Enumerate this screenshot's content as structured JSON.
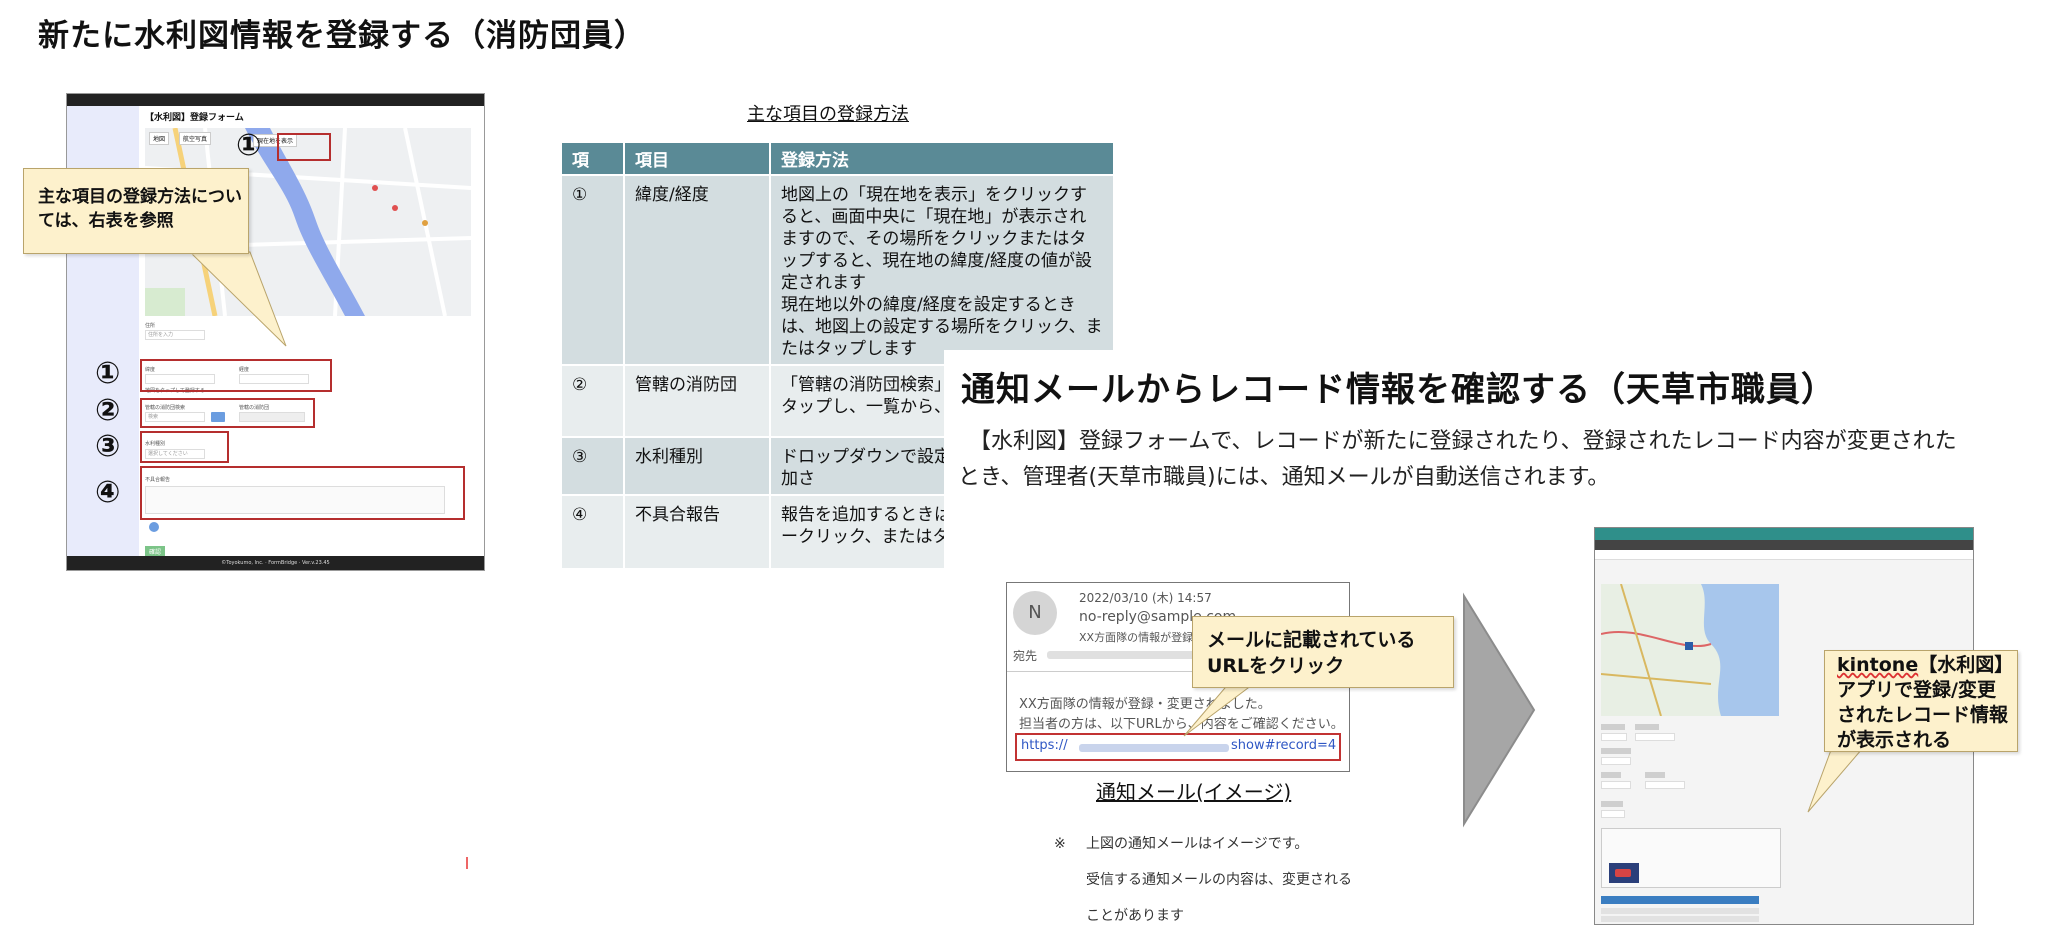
{
  "title_register": "新たに水利図情報を登録する（消防団員）",
  "form_screenshot": {
    "form_title": "【水利図】登録フォーム",
    "map_buttons": [
      "地図",
      "航空写真"
    ],
    "current_location_button": "現在地を表示",
    "labels": [
      "住所",
      "緯度",
      "経度",
      "管轄の消防団検索",
      "管轄の消防団",
      "水利種別",
      "不具合報告"
    ],
    "placeholders": [
      "住所を入力",
      "地図をタップして登録する",
      "検索",
      "選択してください"
    ],
    "confirm_button": "確認",
    "footer": "©Toyokumo, Inc. · FormBridge · Ver.v.23.45"
  },
  "markers": [
    "①",
    "①",
    "②",
    "③",
    "④"
  ],
  "callout_left": "主な項目の登録方法については、右表を参照",
  "table": {
    "caption": "主な項目の登録方法",
    "headers": [
      "項",
      "項目",
      "登録方法"
    ],
    "rows": [
      {
        "no": "①",
        "item": "緯度/経度",
        "method": "地図上の「現在地を表示」をクリックすると、画面中央に「現在地」が表示されますので、その場所をクリックまたはタップすると、現在地の緯度/経度の値が設定されます\n現在地以外の緯度/経度を設定するときは、地図上の設定する場所をクリック、またはタップします"
      },
      {
        "no": "②",
        "item": "管轄の消防団",
        "method": "「管轄の消防団検索」をクリック、またはタップし、一覧から、該当の消防団"
      },
      {
        "no": "③",
        "item": "水利種別",
        "method": "ドロップダウンで設定、さらに項目が追加さ"
      },
      {
        "no": "④",
        "item": "不具合報告",
        "method": "報告を追加するときは左下の「追加(＋マークリック、またはタ"
      }
    ]
  },
  "title_notify": "通知メールからレコード情報を確認する（天草市職員）",
  "description": "　【水利図】登録フォームで、レコードが新たに登録されたり、登録されたレコード内容が変更されたとき、管理者(天草市職員)には、通知メールが自動送信されます。",
  "email": {
    "avatar_letter": "N",
    "datetime": "2022/03/10 (木) 14:57",
    "from": "no-reply@sample.com",
    "subject": "XX方面隊の情報が登録・",
    "to_label": "宛先",
    "body_line1": "XX方面隊の情報が登録・変更されました。",
    "body_line2": "担当者の方は、以下URLから、内容をご確認ください。",
    "url_start": "https://",
    "url_end": "show#record=4",
    "caption": "通知メール(イメージ)"
  },
  "callout_email": "メールに記載されているURLをクリック",
  "note": {
    "mark": "※",
    "lines": [
      "上図の通知メールはイメージです。",
      "受信する通知メールの内容は、変更される",
      "ことがあります"
    ]
  },
  "callout_kintone": {
    "word": "kintone",
    "rest_line1": "【水利図】",
    "line2": "アプリで登録/変更",
    "line3": "されたレコード情報",
    "line4": "が表示される"
  },
  "colors": {
    "table_header": "#5a8a96",
    "table_row_odd": "#d3dde0",
    "table_row_even": "#e8edee",
    "callout_bg": "#fdf1cc",
    "marker_red": "#b52e2e",
    "link_blue": "#2f57c4",
    "arrow_gray": "#a6a6a6"
  }
}
